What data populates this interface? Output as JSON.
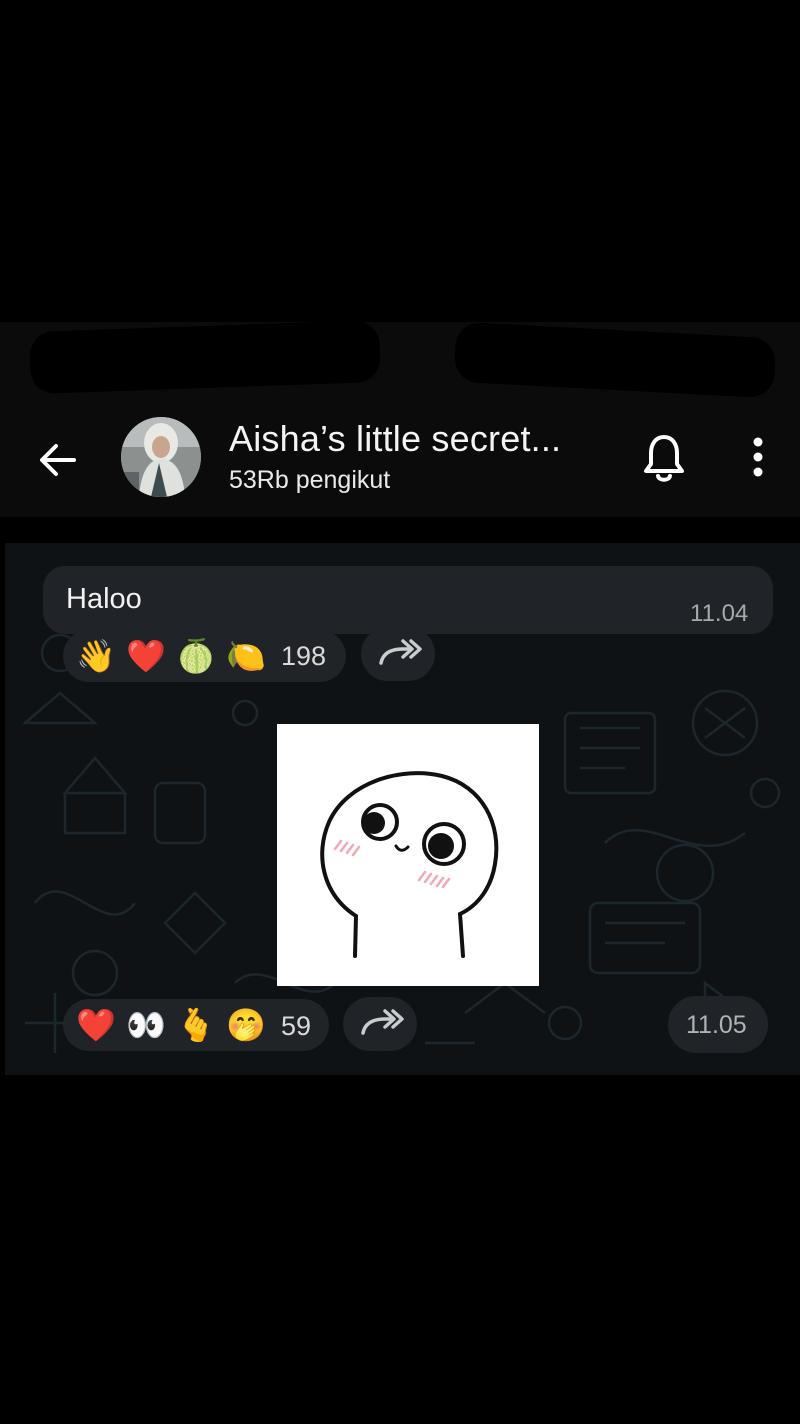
{
  "channel": {
    "title": "Aisha’s little secret...",
    "subtitle": "53Rb pengikut"
  },
  "messages": [
    {
      "text": "Haloo",
      "time": "11.04",
      "reactions": [
        "👋",
        "❤️",
        "🍈",
        "🍋"
      ],
      "reaction_count": "198"
    },
    {
      "type": "sticker",
      "time": "11.05",
      "reactions": [
        "❤️",
        "👀",
        "🫰",
        "🤭"
      ],
      "reaction_count": "59"
    }
  ],
  "icons": {
    "back": "back-arrow-icon",
    "bell": "bell-icon",
    "more": "more-vertical-icon",
    "forward": "forward-icon"
  },
  "colors": {
    "background": "#000000",
    "chat_background": "#0e1214",
    "bubble": "#202327"
  }
}
